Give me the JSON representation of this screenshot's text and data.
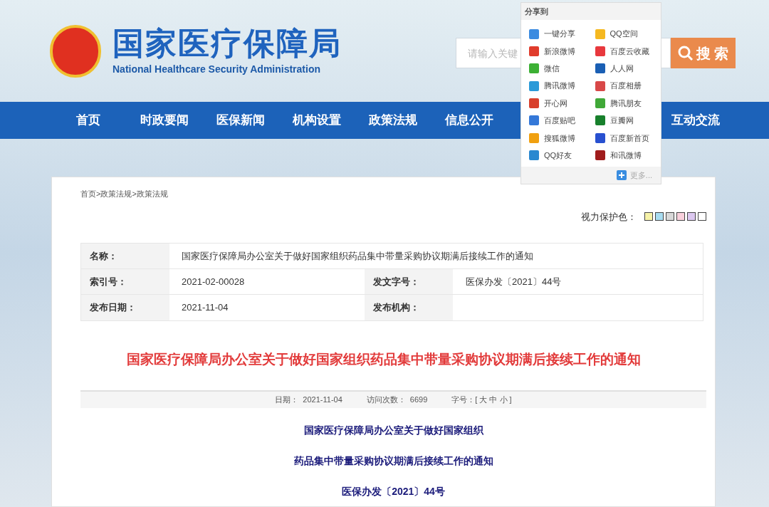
{
  "header": {
    "title": "国家医疗保障局",
    "subtitle": "National Healthcare Security Administration",
    "search": {
      "placeholder": "请输入关键",
      "button": "搜 索"
    }
  },
  "nav": [
    {
      "label": "首页"
    },
    {
      "label": "时政要闻"
    },
    {
      "label": "医保新闻"
    },
    {
      "label": "机构设置"
    },
    {
      "label": "政策法规"
    },
    {
      "label": "信息公开"
    },
    {
      "label": "互动交流"
    }
  ],
  "share_popup": {
    "title": "分享到",
    "items": [
      {
        "label": "一键分享",
        "color": "#3b8be0"
      },
      {
        "label": "QQ空间",
        "color": "#f5b820"
      },
      {
        "label": "新浪微博",
        "color": "#e03c2c"
      },
      {
        "label": "百度云收藏",
        "color": "#e8383d"
      },
      {
        "label": "微信",
        "color": "#3cb034"
      },
      {
        "label": "人人网",
        "color": "#1a5fb4"
      },
      {
        "label": "腾讯微博",
        "color": "#2a9ad8"
      },
      {
        "label": "百度相册",
        "color": "#d84848"
      },
      {
        "label": "开心网",
        "color": "#d8402c"
      },
      {
        "label": "腾讯朋友",
        "color": "#40a838"
      },
      {
        "label": "百度贴吧",
        "color": "#3478d8"
      },
      {
        "label": "豆瓣网",
        "color": "#18802c"
      },
      {
        "label": "搜狐微博",
        "color": "#f0a010"
      },
      {
        "label": "百度新首页",
        "color": "#2850d0"
      },
      {
        "label": "QQ好友",
        "color": "#2a88d0"
      },
      {
        "label": "和讯微博",
        "color": "#a01c1c"
      }
    ],
    "more": "更多..."
  },
  "breadcrumb": "首页>政策法规>政策法规",
  "eye_care": {
    "label": "视力保护色：",
    "swatches": [
      {
        "color": "#f6f2a8"
      },
      {
        "color": "#a8dcf0"
      },
      {
        "color": "#d8d8d8"
      },
      {
        "color": "#f8d0dc"
      },
      {
        "color": "#dcc8f0"
      },
      {
        "color": "#ffffff"
      }
    ]
  },
  "info_table": {
    "rows": [
      [
        {
          "label": "名称：",
          "value": "国家医疗保障局办公室关于做好国家组织药品集中带量采购协议期满后接续工作的通知"
        }
      ],
      [
        {
          "label": "索引号：",
          "value": "2021-02-00028"
        },
        {
          "label": "发文字号：",
          "value": "医保办发〔2021〕44号"
        }
      ],
      [
        {
          "label": "发布日期：",
          "value": "2021-11-04"
        },
        {
          "label": "发布机构："
        }
      ]
    ]
  },
  "article": {
    "title": "国家医疗保障局办公室关于做好国家组织药品集中带量采购协议期满后接续工作的通知",
    "meta": [
      {
        "label": "日期：",
        "value": "2021-11-04"
      },
      {
        "label": "访问次数：",
        "value": "6699"
      },
      {
        "label": "字号：",
        "value": "[ 大 中 小 ]"
      }
    ],
    "body": [
      "国家医疗保障局办公室关于做好国家组织",
      "药品集中带量采购协议期满后接续工作的通知",
      "医保办发〔2021〕44号"
    ]
  }
}
